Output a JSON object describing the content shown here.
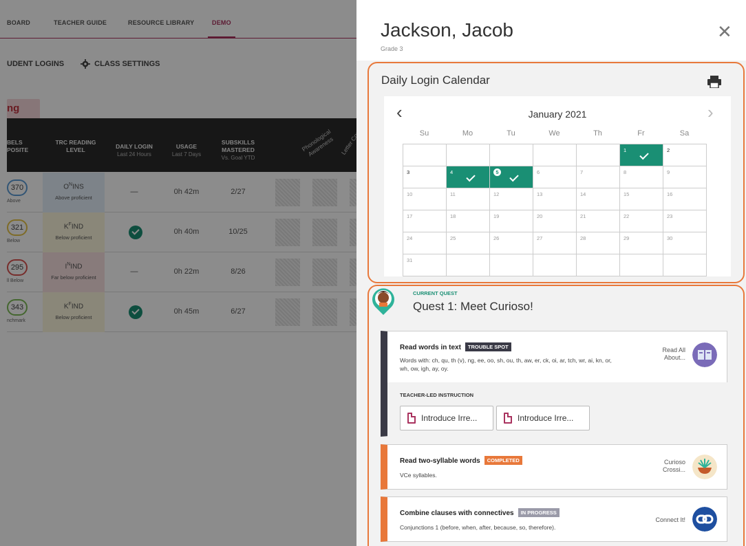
{
  "nav": {
    "items": [
      "BOARD",
      "TEACHER GUIDE",
      "RESOURCE LIBRARY",
      "DEMO"
    ],
    "active": "DEMO"
  },
  "subnav": {
    "logins": "UDENT LOGINS",
    "settings": "CLASS SETTINGS"
  },
  "tab": {
    "label": "ng"
  },
  "table": {
    "headers": {
      "composite": [
        "BELS",
        "POSITE"
      ],
      "trc": [
        "TRC READING",
        "LEVEL"
      ],
      "login": {
        "title": "DAILY LOGIN",
        "sub": "Last 24 Hours"
      },
      "usage": {
        "title": "USAGE",
        "sub": "Last 7 Days"
      },
      "subskills": {
        "title": [
          "SUBSKILLS",
          "MASTERED"
        ],
        "sub": "Vs. Goal YTD"
      },
      "phono": "Phonological Awareness",
      "letter": "Letter Corr"
    },
    "rows": [
      {
        "score": "370",
        "score_label": "Above",
        "level": "O",
        "level_sup": "N",
        "level_suffix": "INS",
        "level_desc": "Above proficient",
        "login": "—",
        "usage": "0h 42m",
        "subskills": "2/27",
        "color": "#5b9bd5",
        "bg": "#e3eef9"
      },
      {
        "score": "321",
        "score_label": "Below",
        "level": "K",
        "level_sup": "F",
        "level_suffix": "IND",
        "level_desc": "Below proficient",
        "login": "check",
        "usage": "0h 40m",
        "subskills": "10/25",
        "color": "#e6c347",
        "bg": "#fbf6dd"
      },
      {
        "score": "295",
        "score_label": "ll Below",
        "level": "I",
        "level_sup": "N",
        "level_suffix": "IND",
        "level_desc": "Far below proficient",
        "login": "—",
        "usage": "0h 22m",
        "subskills": "8/26",
        "color": "#d9534f",
        "bg": "#f7e0e0"
      },
      {
        "score": "343",
        "score_label": "nchmark",
        "level": "K",
        "level_sup": "F",
        "level_suffix": "IND",
        "level_desc": "Below proficient",
        "login": "check",
        "usage": "0h 45m",
        "subskills": "6/27",
        "color": "#7dbb57",
        "bg": "#fbf6dd"
      }
    ]
  },
  "panel": {
    "student_name": "Jackson, Jacob",
    "grade": "Grade 3",
    "calendar": {
      "title": "Daily Login Calendar",
      "month": "January 2021",
      "days_of_week": [
        "Su",
        "Mo",
        "Tu",
        "We",
        "Th",
        "Fr",
        "Sa"
      ],
      "weeks": [
        [
          "",
          "",
          "",
          "",
          "",
          "1",
          "2"
        ],
        [
          "3",
          "4",
          "5",
          "6",
          "7",
          "8",
          "9"
        ],
        [
          "10",
          "11",
          "12",
          "13",
          "14",
          "15",
          "16"
        ],
        [
          "17",
          "18",
          "19",
          "20",
          "21",
          "22",
          "23"
        ],
        [
          "24",
          "25",
          "26",
          "27",
          "28",
          "29",
          "30"
        ],
        [
          "31",
          "",
          "",
          "",
          "",
          "",
          ""
        ]
      ],
      "logged_in_days": [
        "1",
        "4",
        "5"
      ],
      "today": "5",
      "elapsed_through": 5
    },
    "quest": {
      "label": "CURRENT QUEST",
      "title": "Quest 1: Meet Curioso!",
      "cards": [
        {
          "title": "Read words in text",
          "tag": "TROUBLE SPOT",
          "tag_color": "#3a3a46",
          "bar_color": "#3a3a46",
          "desc": "Words with: ch, qu, th (v), ng, ee, oo, sh, ou, th, aw, er, ck, oi, ar, tch, wr, ai, kn, or, wh, ow, igh, ay, oy.",
          "activity": "Read All About...",
          "icon_color": "#7a6bb8"
        },
        {
          "title": "Read two-syllable words",
          "tag": "COMPLETED",
          "tag_color": "#e8783a",
          "bar_color": "#e8783a",
          "desc": "VCe syllables.",
          "activity": "Curioso Crossi...",
          "icon_color": "#f5e6c8"
        },
        {
          "title": "Combine clauses with connectives",
          "tag": "IN PROGRESS",
          "tag_color": "#9a9aa8",
          "bar_color": "#e8783a",
          "desc": "Conjunctions 1 (before, when, after, because, so, therefore).",
          "activity": "Connect It!",
          "icon_color": "#1e4fa0"
        }
      ],
      "teacher_led": {
        "label": "TEACHER-LED INSTRUCTION",
        "buttons": [
          "Introduce Irre...",
          "Introduce Irre..."
        ]
      }
    }
  }
}
